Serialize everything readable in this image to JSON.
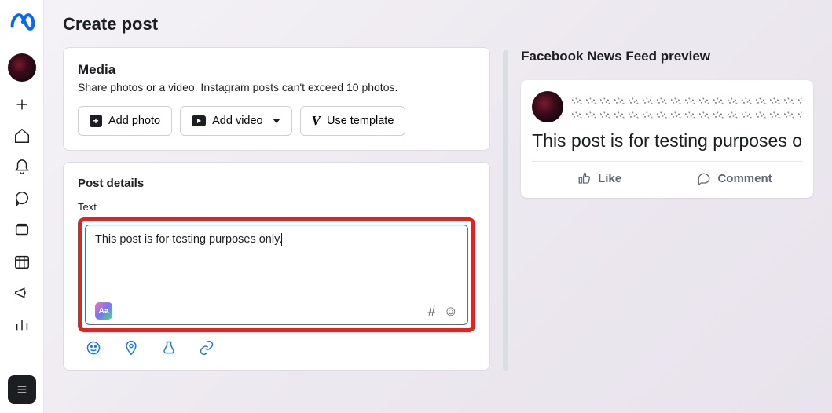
{
  "page_title": "Create post",
  "media_card": {
    "title": "Media",
    "subtitle": "Share photos or a video. Instagram posts can't exceed 10 photos.",
    "add_photo_label": "Add photo",
    "add_video_label": "Add video",
    "use_template_label": "Use template"
  },
  "post_details": {
    "section_label": "Post details",
    "text_label": "Text",
    "text_value": "This post is for testing purposes only.",
    "style_chip_label": "Aa",
    "hashtag": "#",
    "emoji": "☺"
  },
  "preview": {
    "title": "Facebook News Feed preview",
    "post_text": "This post is for testing purposes o",
    "like_label": "Like",
    "comment_label": "Comment"
  }
}
